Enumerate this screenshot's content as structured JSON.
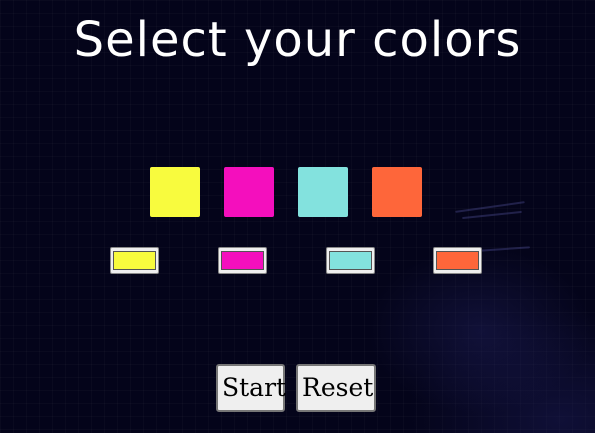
{
  "page": {
    "title": "Select your colors"
  },
  "swatches": [
    {
      "name": "yellow",
      "color": "#f8fb3e"
    },
    {
      "name": "magenta",
      "color": "#f40fbd"
    },
    {
      "name": "cyan",
      "color": "#83e2de"
    },
    {
      "name": "orange",
      "color": "#fe663a"
    }
  ],
  "pickers": [
    {
      "value": "#f8fb3e"
    },
    {
      "value": "#f40fbd"
    },
    {
      "value": "#83e2de"
    },
    {
      "value": "#fe663a"
    }
  ],
  "controls": {
    "start_label": "Start",
    "reset_label": "Reset"
  },
  "colors": {
    "background": "#04041a",
    "title_text": "#ffffff"
  }
}
